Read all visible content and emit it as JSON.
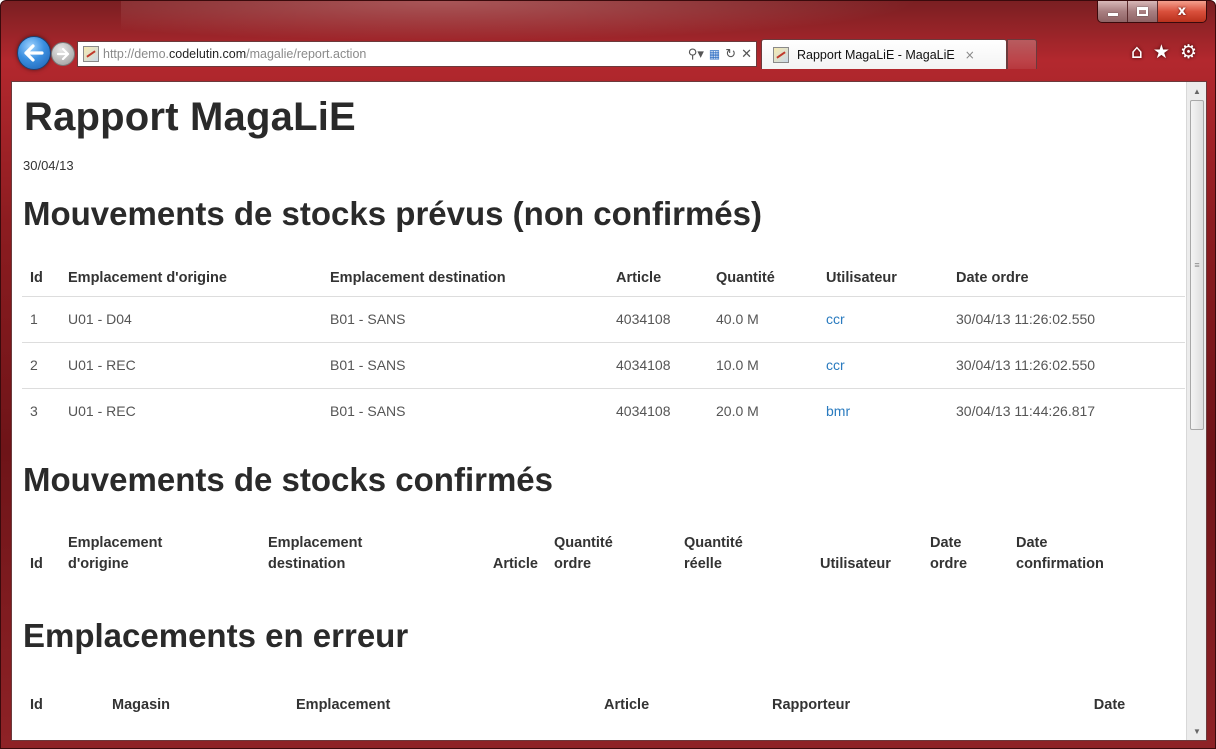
{
  "browser": {
    "url_prefix": "http://demo.",
    "url_host": "codelutin.com",
    "url_path": "/magalie/report.action",
    "tab_title": "Rapport MagaLiE - MagaLiE",
    "tab_close": "×",
    "icons": {
      "back": "back-arrow-icon",
      "forward": "forward-arrow-icon",
      "search": "search-icon",
      "compat": "compatibility-view-icon",
      "refresh": "refresh-icon",
      "stop": "stop-icon",
      "home": "home-icon",
      "favorites": "star-icon",
      "tools": "gear-icon"
    },
    "window_buttons": {
      "minimize": "–",
      "maximize": "□",
      "close": "x"
    }
  },
  "page": {
    "title": "Rapport MagaLiE",
    "date": "30/04/13"
  },
  "planned": {
    "title": "Mouvements de stocks prévus (non confirmés)",
    "headers": [
      "Id",
      "Emplacement d'origine",
      "Emplacement destination",
      "Article",
      "Quantité",
      "Utilisateur",
      "Date ordre"
    ],
    "rows": [
      {
        "id": "1",
        "origin": "U01 - D04",
        "destination": "B01 - SANS",
        "article": "4034108",
        "quantity": "40.0 M",
        "user": "ccr",
        "date": "30/04/13 11:26:02.550"
      },
      {
        "id": "2",
        "origin": "U01 - REC",
        "destination": "B01 - SANS",
        "article": "4034108",
        "quantity": "10.0 M",
        "user": "ccr",
        "date": "30/04/13 11:26:02.550"
      },
      {
        "id": "3",
        "origin": "U01 - REC",
        "destination": "B01 - SANS",
        "article": "4034108",
        "quantity": "20.0 M",
        "user": "bmr",
        "date": "30/04/13 11:44:26.817"
      }
    ]
  },
  "confirmed": {
    "title": "Mouvements de stocks confirmés",
    "headers": {
      "id": "Id",
      "origin_1": "Emplacement",
      "origin_2": "d'origine",
      "dest_1": "Emplacement",
      "dest_2": "destination",
      "article": "Article",
      "qty_order_1": "Quantité",
      "qty_order_2": "ordre",
      "qty_real_1": "Quantité",
      "qty_real_2": "réelle",
      "user": "Utilisateur",
      "date_order_1": "Date",
      "date_order_2": "ordre",
      "date_conf_1": "Date",
      "date_conf_2": "confirmation"
    }
  },
  "errors": {
    "title": "Emplacements en erreur",
    "headers": [
      "Id",
      "Magasin",
      "Emplacement",
      "Article",
      "Rapporteur",
      "Date"
    ]
  },
  "colors": {
    "frame": "#8c1c20",
    "link": "#2a7bbf",
    "heading": "#2a2a2a"
  }
}
